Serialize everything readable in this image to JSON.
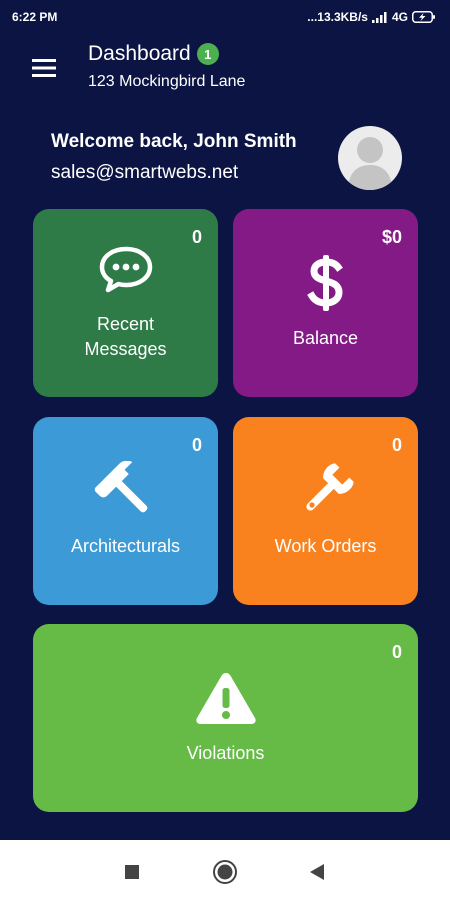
{
  "status_bar": {
    "time": "6:22 PM",
    "network_speed": "...13.3KB/s",
    "network_type": "4G",
    "icons": [
      "signal-icon",
      "battery-charging-icon"
    ]
  },
  "app_bar": {
    "title": "Dashboard",
    "notification_count": "1",
    "subtitle": "123 Mockingbird Lane",
    "menu_icon": "hamburger-menu-icon"
  },
  "welcome": {
    "greeting": "Welcome back, John Smith",
    "email": "sales@smartwebs.net",
    "avatar_icon": "user-avatar-icon"
  },
  "tiles": [
    {
      "label": "Recent\nMessages",
      "count": "0",
      "icon": "chat-bubble-icon",
      "color": "#2e7b47"
    },
    {
      "label": "Balance",
      "count": "$0",
      "icon": "dollar-icon",
      "color": "#841a85"
    },
    {
      "label": "Architecturals",
      "count": "0",
      "icon": "hammer-icon",
      "color": "#3c9ad6"
    },
    {
      "label": "Work Orders",
      "count": "0",
      "icon": "wrench-icon",
      "color": "#f9821e"
    },
    {
      "label": "Violations",
      "count": "0",
      "icon": "warning-icon",
      "color": "#65bb45"
    }
  ],
  "colors": {
    "background": "#0c1444",
    "accent_badge": "#4caf50"
  },
  "nav_bar": {
    "icons": [
      "recents-square-icon",
      "home-circle-icon",
      "back-triangle-icon"
    ]
  }
}
